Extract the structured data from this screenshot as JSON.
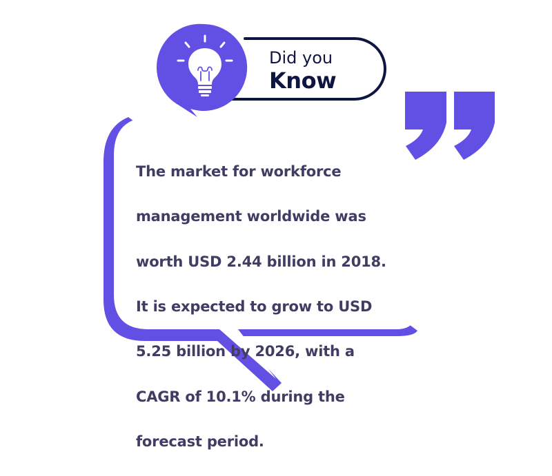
{
  "badge": {
    "line1": "Did you",
    "line2": "Know",
    "icon": "lightbulb-icon"
  },
  "quote_icon": "closing-quote-icon",
  "fact": {
    "lines": [
      "The market for workforce",
      "management worldwide was",
      "worth USD 2.44 billion in 2018.",
      "It is expected to grow to USD",
      "5.25 billion by 2026, with a",
      "CAGR of 10.1% during the",
      "forecast period."
    ]
  },
  "colors": {
    "accent": "#6250e5",
    "text": "#3f3d63",
    "badge_outline": "#0f1541",
    "background": "#ffffff"
  }
}
